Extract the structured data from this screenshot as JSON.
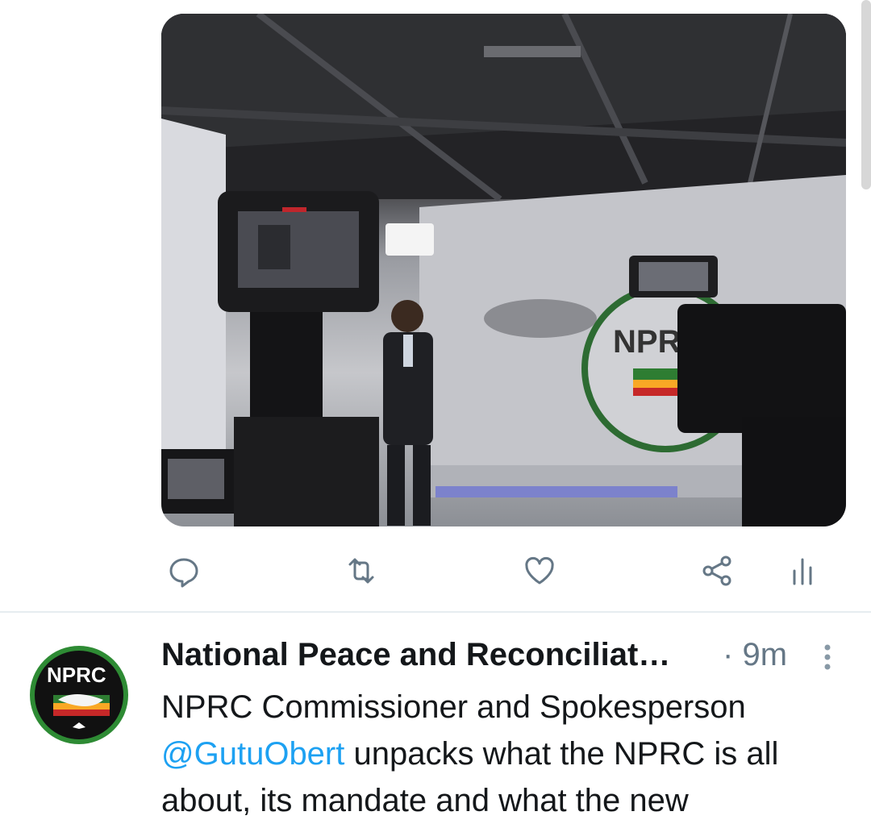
{
  "tweet": {
    "author_name": "National Peace and Reconciliat…",
    "separator": "·",
    "time_ago": "9m",
    "text_part1": "NPRC Commissioner and Spokesperson",
    "mention": "@GutuObert",
    "text_part2": " unpacks what the NPRC is all about, its mandate and what the new"
  },
  "media": {
    "backdrop_logo_text": "NPRC"
  },
  "avatar": {
    "logo_text": "NPRC"
  },
  "icons": {
    "reply": "reply-icon",
    "retweet": "retweet-icon",
    "like": "heart-icon",
    "share": "share-icon",
    "analytics": "analytics-icon",
    "more": "more-vertical-icon"
  },
  "colors": {
    "accent": "#1da1f2",
    "icon_gray": "#657786",
    "text": "#14171a"
  }
}
